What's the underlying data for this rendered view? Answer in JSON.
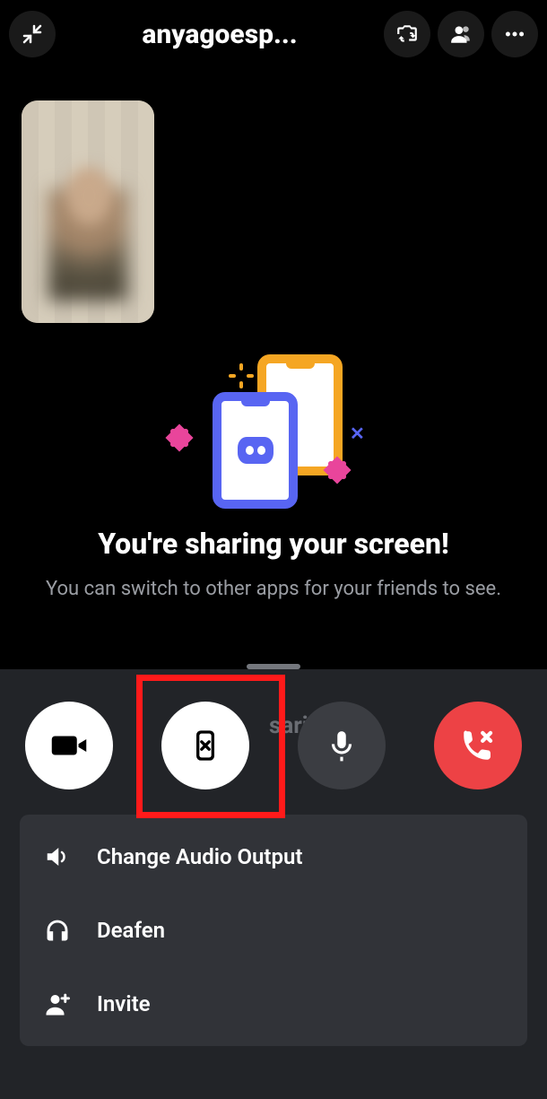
{
  "header": {
    "title": "anyagoesp..."
  },
  "share": {
    "heading": "You're sharing your screen!",
    "subtext": "You can switch to other apps for your friends to see.",
    "ghost_label": "saring"
  },
  "menu": {
    "items": [
      {
        "label": "Change Audio Output"
      },
      {
        "label": "Deafen"
      },
      {
        "label": "Invite"
      }
    ]
  }
}
